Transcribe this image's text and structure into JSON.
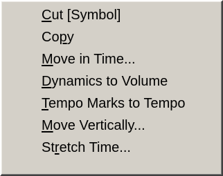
{
  "context_menu": {
    "items": [
      {
        "label": "Cut [Symbol]",
        "mnemonic": "C",
        "mnemonic_index": 0
      },
      {
        "label": "Copy",
        "mnemonic": "p",
        "mnemonic_index": 2
      },
      {
        "label": "Move in Time...",
        "mnemonic": "M",
        "mnemonic_index": 0
      },
      {
        "label": "Dynamics to Volume",
        "mnemonic": "D",
        "mnemonic_index": 0
      },
      {
        "label": "Tempo Marks to Tempo",
        "mnemonic": "T",
        "mnemonic_index": 0
      },
      {
        "label": "Move Vertically...",
        "mnemonic": "M",
        "mnemonic_index": 0
      },
      {
        "label": "Stretch Time...",
        "mnemonic": "t",
        "mnemonic_index": 2
      }
    ]
  },
  "colors": {
    "menu_background": "#d4d0c8",
    "text": "#000000"
  }
}
